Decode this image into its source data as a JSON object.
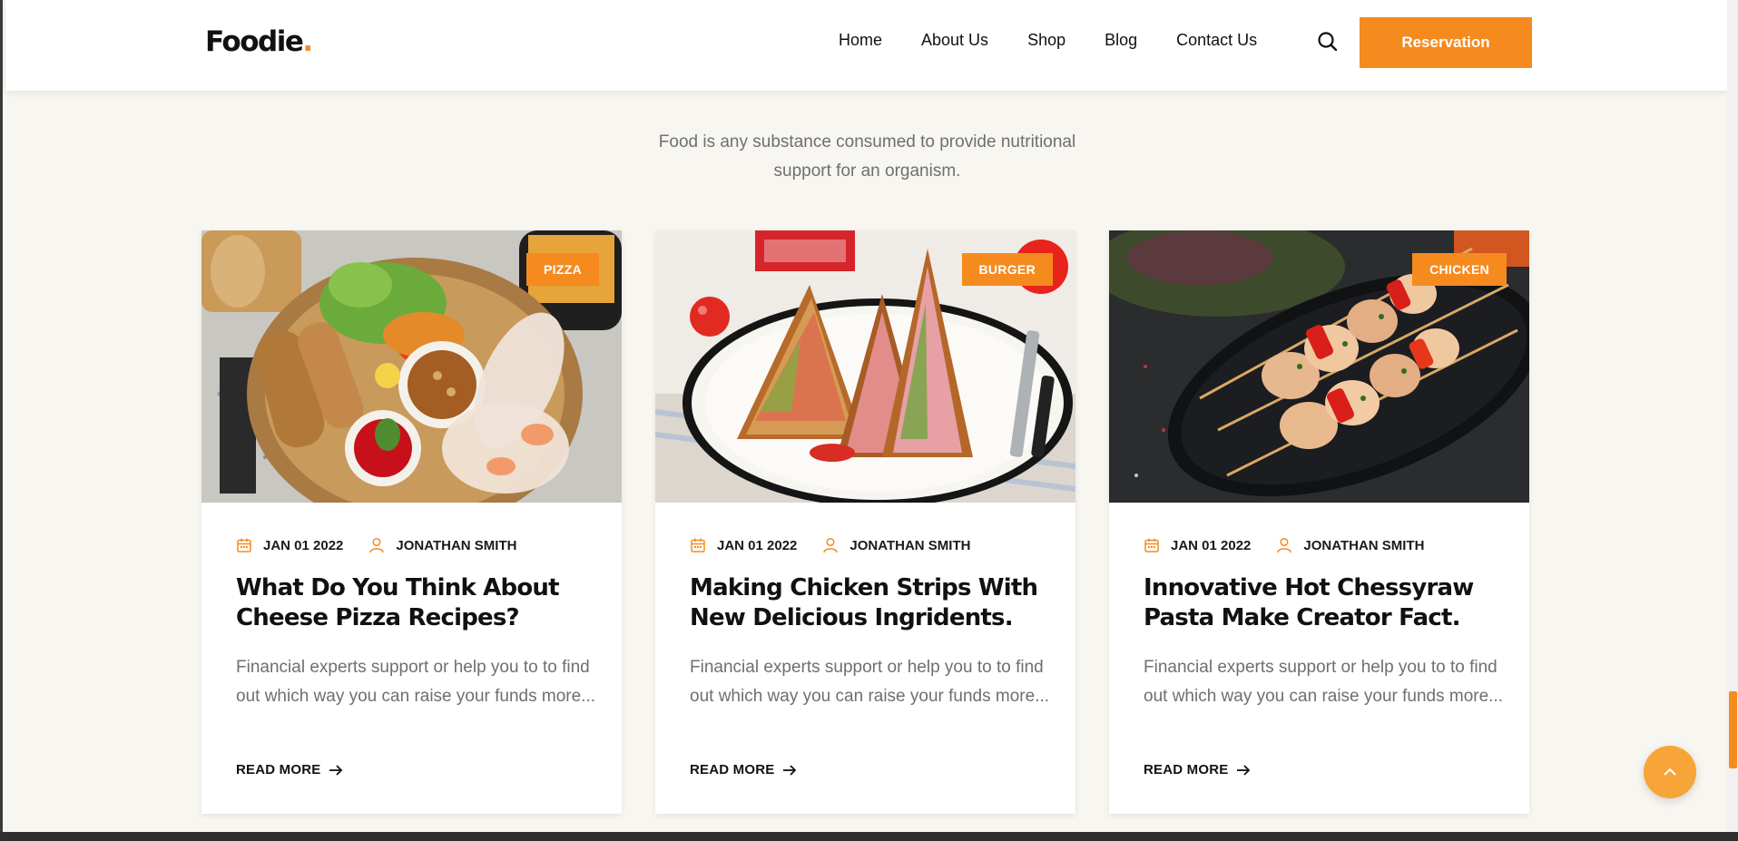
{
  "brand": {
    "name": "Foodie",
    "dot": ".",
    "accent": "#f58b1f"
  },
  "nav": {
    "items": [
      "Home",
      "About Us",
      "Shop",
      "Blog",
      "Contact Us"
    ],
    "search_icon": "search-icon",
    "cta_label": "Reservation"
  },
  "section": {
    "subtitle": "Food is any substance consumed to provide nutritional support for an organism."
  },
  "cards": [
    {
      "tag": "PIZZA",
      "image": "asian-platter-with-spring-rolls-photo",
      "date": "JAN 01 2022",
      "author": "JONATHAN SMITH",
      "title": "What Do You Think About Cheese Pizza Recipes?",
      "excerpt": "Financial experts support or help you to to find out which way you can raise your funds more...",
      "read_more": "READ MORE"
    },
    {
      "tag": "BURGER",
      "image": "grilled-sandwich-on-plate-photo",
      "date": "JAN 01 2022",
      "author": "JONATHAN SMITH",
      "title": "Making Chicken Strips With New Delicious Ingridents.",
      "excerpt": "Financial experts support or help you to to find out which way you can raise your funds more...",
      "read_more": "READ MORE"
    },
    {
      "tag": "CHICKEN",
      "image": "chicken-skewers-on-dark-plate-photo",
      "date": "JAN 01 2022",
      "author": "JONATHAN SMITH",
      "title": "Innovative Hot Chessyraw Pasta Make Creator Fact.",
      "excerpt": "Financial experts support or help you to to find out which way you can raise your funds more...",
      "read_more": "READ MORE"
    }
  ],
  "icons": {
    "date": "calendar-icon",
    "author": "user-icon",
    "read_more": "arrow-right-icon",
    "scroll_top": "chevron-up-icon"
  },
  "colors": {
    "accent": "#f58b1f",
    "page_bg": "#f8f6f1",
    "text_muted": "#6f6f6f"
  }
}
